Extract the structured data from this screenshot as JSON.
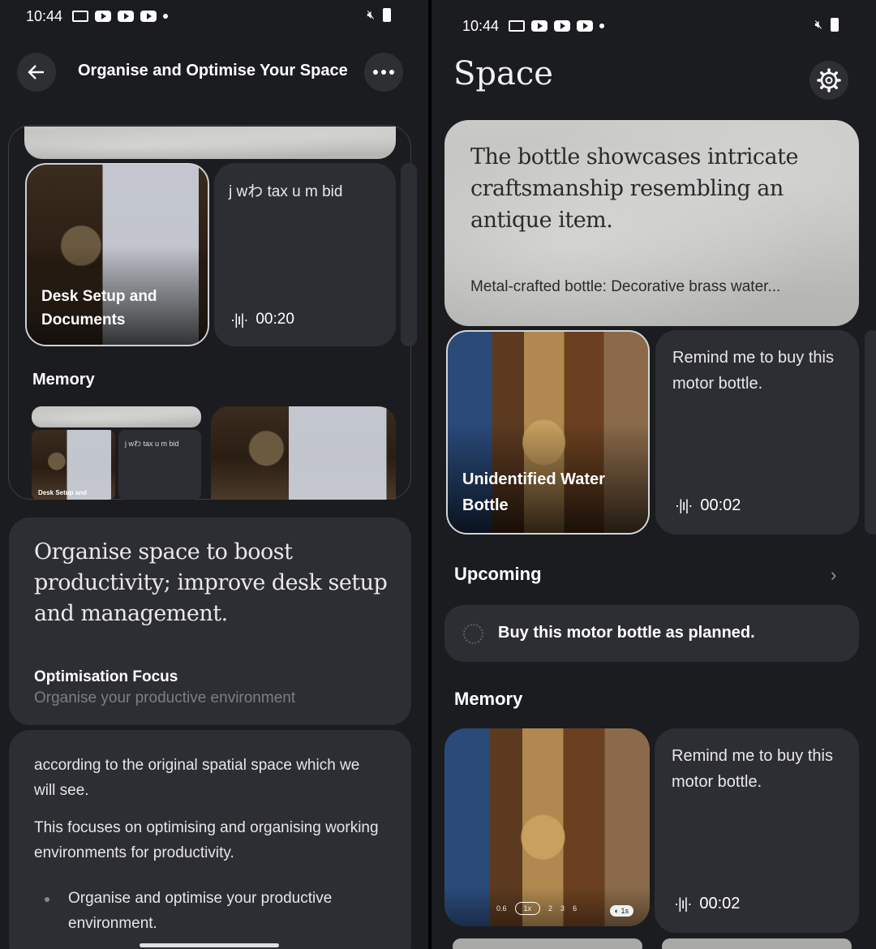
{
  "left": {
    "status": {
      "time": "10:44"
    },
    "header": {
      "title": "Organise and Optimise Your Space"
    },
    "cards": [
      {
        "title": "Desk Setup and Documents"
      },
      {
        "text": "j wわ tax u m bid",
        "duration": "00:20"
      }
    ],
    "memory": {
      "label": "Memory",
      "mini_card_title": "Desk Setup and",
      "mini_card_text": "j wわ tax u m bid"
    },
    "summary": {
      "headline": "Organise space to boost productivity; improve desk setup and management.",
      "focus_label": "Optimisation Focus",
      "focus_value": "Organise your productive environment"
    },
    "detail": {
      "p1": "according to the original spatial space which we will see.",
      "p2": "This focuses on optimising and organising working environments for productivity.",
      "bullet1": "Organise and optimise your productive environment."
    }
  },
  "right": {
    "status": {
      "time": "10:44"
    },
    "header": {
      "title": "Space"
    },
    "hero": {
      "quote": "The bottle showcases intricate craftsmanship resembling an antique item.",
      "caption": "Metal-crafted bottle: Decorative brass water..."
    },
    "cards": [
      {
        "title": "Unidentified Water Bottle"
      },
      {
        "text": "Remind me to buy this motor bottle.",
        "duration": "00:02"
      }
    ],
    "upcoming": {
      "label": "Upcoming",
      "item": "Buy this motor bottle as planned."
    },
    "memory": {
      "label": "Memory",
      "card_text": "Remind me to buy this motor bottle.",
      "duration": "00:02",
      "zoom_levels": [
        "0.6",
        "1x",
        "2",
        "3",
        "6"
      ],
      "timer": "1s"
    }
  },
  "colors": {
    "background": "#1b1c1f",
    "card": "#2d2e33",
    "focus_subtle": "#7c7e85"
  }
}
